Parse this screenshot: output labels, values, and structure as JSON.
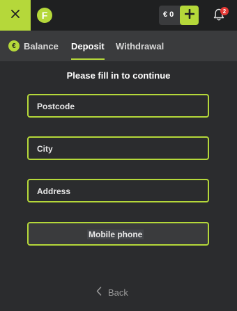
{
  "topbar": {
    "close_icon": "close-icon",
    "logo_letter": "F",
    "balance_amount": "€ 0",
    "add_icon": "plus-icon",
    "bell_icon": "bell-icon",
    "notification_count": "2",
    "accent_color": "#b5d83a"
  },
  "tabs": [
    {
      "label": "Balance",
      "icon": "euro-icon"
    },
    {
      "label": "Deposit",
      "active": true
    },
    {
      "label": "Withdrawal"
    }
  ],
  "form": {
    "prompt": "Please fill in to continue",
    "fields": [
      {
        "label": "Postcode"
      },
      {
        "label": "City"
      },
      {
        "label": "Address"
      },
      {
        "label": "Mobile phone"
      }
    ]
  },
  "footer": {
    "back_label": "Back",
    "back_icon": "chevron-left-icon"
  }
}
